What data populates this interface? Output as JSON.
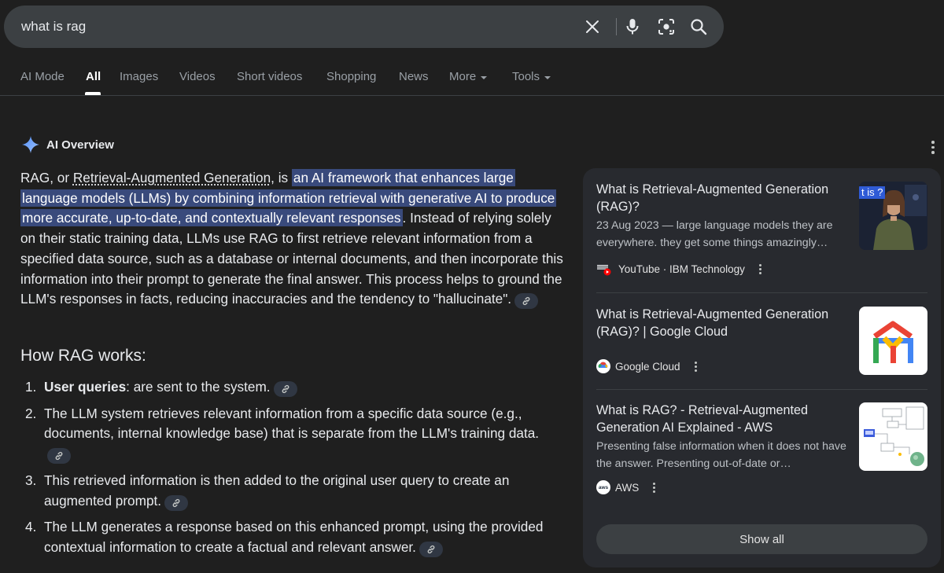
{
  "search": {
    "query": "what is rag"
  },
  "tabs": [
    {
      "label": "AI Mode"
    },
    {
      "label": "All"
    },
    {
      "label": "Images"
    },
    {
      "label": "Videos"
    },
    {
      "label": "Short videos"
    },
    {
      "label": "Shopping"
    },
    {
      "label": "News"
    },
    {
      "label": "More"
    },
    {
      "label": "Tools"
    }
  ],
  "ai_overview": {
    "title": "AI Overview",
    "intro_prefix": "RAG, or ",
    "intro_term": "Retrieval-Augmented Generation",
    "intro_is": ", is ",
    "intro_highlight": "an AI framework that enhances large language models (LLMs) by combining information retrieval with generative AI to produce more accurate, up-to-date, and contextually relevant responses",
    "intro_rest": ". Instead of relying solely on their static training data, LLMs use RAG to first retrieve relevant information from a specified data source, such as a database or internal documents, and then incorporate this information into their prompt to generate the final answer. This process helps to ground the LLM's responses in facts, reducing inaccuracies and the tendency to \"hallucinate\".",
    "how_heading": "How RAG works:",
    "steps": [
      {
        "num": "1.",
        "bold": "User queries",
        "text": ": are sent to the system."
      },
      {
        "num": "2.",
        "bold": "",
        "text": "The LLM system retrieves relevant information from a specific data source (e.g., documents, internal knowledge base) that is separate from the LLM's training data."
      },
      {
        "num": "3.",
        "bold": "",
        "text": "This retrieved information is then added to the original user query to create an augmented prompt."
      },
      {
        "num": "4.",
        "bold": "",
        "text": "The LLM generates a response based on this enhanced prompt, using the provided contextual information to create a factual and relevant answer."
      }
    ]
  },
  "sources": [
    {
      "title": "What is Retrieval-Augmented Generation (RAG)?",
      "snippet": "23 Aug 2023 — large language models they are everywhere. they get some things amazingly…",
      "source": "YouTube · IBM Technology",
      "favicon": "ibm-youtube-icon",
      "thumb_text": "t is ?"
    },
    {
      "title": "What is Retrieval-Augmented Generation (RAG)? | Google Cloud",
      "snippet": "",
      "source": "Google Cloud",
      "favicon": "google-cloud-icon"
    },
    {
      "title": "What is RAG? - Retrieval-Augmented Generation AI Explained - AWS",
      "snippet": "Presenting false information when it does not have the answer. Presenting out-of-date or…",
      "source": "AWS",
      "favicon": "aws-icon",
      "favicon_text": "aws"
    }
  ],
  "show_all_label": "Show all",
  "colors": {
    "background": "#1f1f1f",
    "highlight": "#394a7c",
    "panel": "#282a2f"
  }
}
